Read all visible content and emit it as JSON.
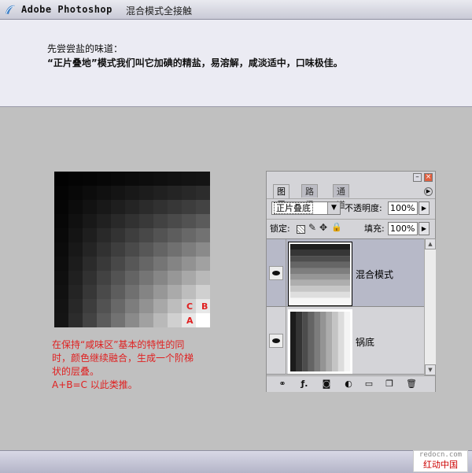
{
  "header": {
    "app_title": "Adobe Photoshop",
    "subtitle": "混合模式全接触"
  },
  "intro": {
    "line1": "先尝尝盐的味道：",
    "line2": "“正片叠地”模式我们叫它加碘的精盐，易溶解，咸淡适中，口味极佳。"
  },
  "illustration": {
    "label_c": "C",
    "label_b": "B",
    "label_a": "A",
    "caption": [
      "在保持“咸味区”基本的特性的同",
      "时，颜色继续融合，生成一个阶梯",
      "状的层叠。",
      "A+B=C 以此类推。"
    ]
  },
  "layers_panel": {
    "tabs": [
      "图层",
      "路径",
      "通道"
    ],
    "active_tab": 0,
    "blend_mode": "正片叠底",
    "opacity_label": "不透明度:",
    "opacity_value": "100%",
    "lock_label": "锁定:",
    "fill_label": "填充:",
    "fill_value": "100%",
    "layers": [
      {
        "name": "混合模式",
        "selected": true,
        "visible": true
      },
      {
        "name": "锅底",
        "selected": false,
        "visible": true
      }
    ],
    "icons": [
      "link-icon",
      "layer-style-icon",
      "mask-icon",
      "adjustment-icon",
      "folder-icon",
      "new-layer-icon",
      "trash-icon"
    ]
  },
  "watermark": {
    "url": "redocn.com",
    "name": "红动中国"
  }
}
